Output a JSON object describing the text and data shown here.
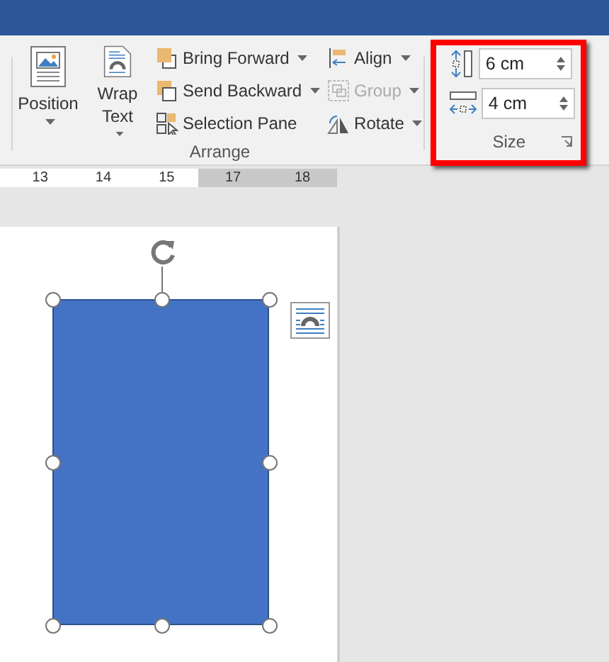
{
  "ribbon": {
    "large_buttons": [
      {
        "kind": "position",
        "label": "Position"
      },
      {
        "kind": "wrap",
        "label": "Wrap Text"
      }
    ],
    "order_buttons": [
      {
        "kind": "forward",
        "label": "Bring Forward",
        "dropdown": true,
        "disabled": false
      },
      {
        "kind": "backward",
        "label": "Send Backward",
        "dropdown": true,
        "disabled": false
      },
      {
        "kind": "pane",
        "label": "Selection Pane",
        "dropdown": false,
        "disabled": false
      }
    ],
    "align_buttons": [
      {
        "kind": "align",
        "label": "Align",
        "dropdown": true,
        "disabled": false
      },
      {
        "kind": "group",
        "label": "Group",
        "dropdown": true,
        "disabled": true
      },
      {
        "kind": "rotate",
        "label": "Rotate",
        "dropdown": true,
        "disabled": false
      }
    ],
    "arrange_label": "Arrange",
    "size": {
      "highlighted": true,
      "label": "Size",
      "fields": [
        {
          "kind": "height",
          "value": "6 cm"
        },
        {
          "kind": "width",
          "value": "4 cm"
        }
      ]
    }
  },
  "ruler": {
    "labels": [
      "13",
      "14",
      "15",
      "17",
      "18"
    ]
  },
  "shape": {
    "selected": true
  }
}
